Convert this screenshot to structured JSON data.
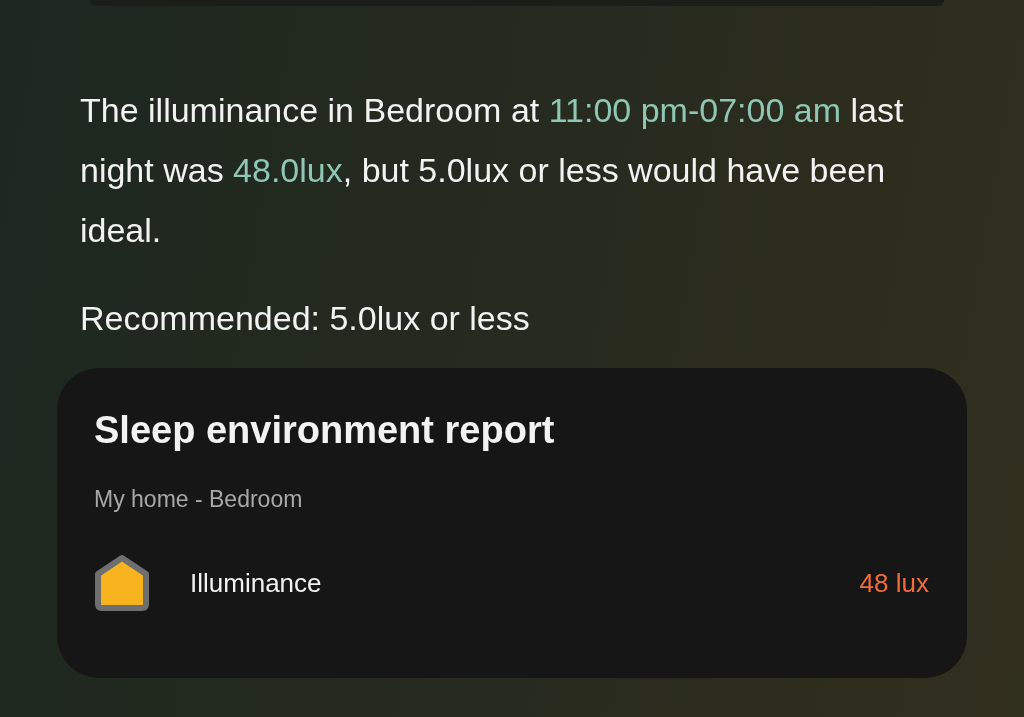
{
  "message": [
    {
      "text": "The illuminance in Bedroom at ",
      "highlight": false
    },
    {
      "text": "11:00 pm-07:00 am",
      "highlight": true
    },
    {
      "text": " last night was ",
      "highlight": false
    },
    {
      "text": "48.0lux",
      "highlight": true
    },
    {
      "text": ", but 5.0lux or less would have been ideal.",
      "highlight": false
    }
  ],
  "recommendation": "Recommended: 5.0lux or less",
  "report": {
    "title": "Sleep environment report",
    "location": "My home - Bedroom",
    "items": [
      {
        "label": "Illuminance",
        "value": "48 lux",
        "color": "#f36b3b"
      }
    ]
  }
}
